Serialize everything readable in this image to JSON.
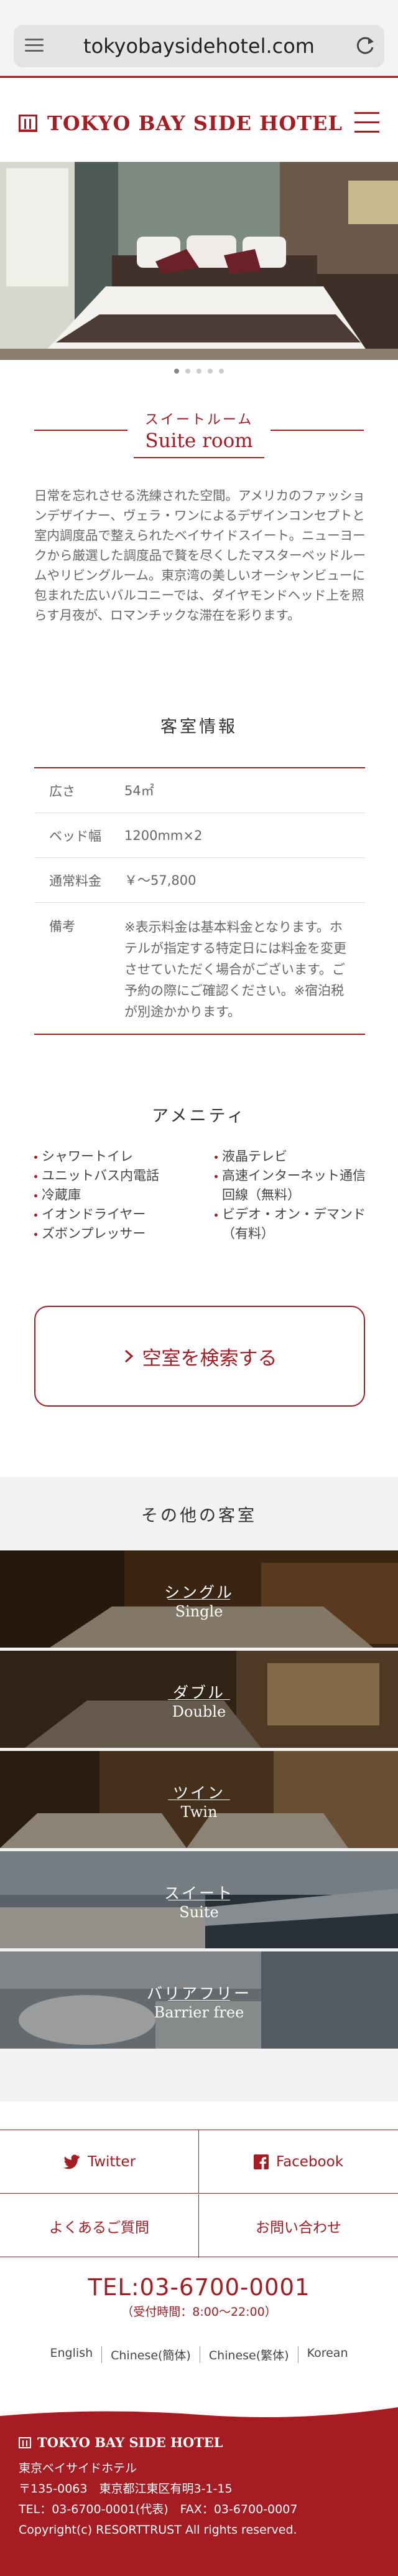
{
  "browser": {
    "url": "tokyobaysidehotel.com"
  },
  "header": {
    "logo_text": "TOKYO BAY SIDE HOTEL"
  },
  "room": {
    "title_ja": "スイートルーム",
    "title_en": "Suite room",
    "description": "日常を忘れさせる洗練された空間。アメリカのファッションデザイナー、ヴェラ・ワンによるデザインコンセプトと室内調度品で整えられたベイサイドスイート。ニューヨークから厳選した調度品で贅を尽くしたマスターベッドルームやリビングルーム。東京湾の美しいオーシャンビューに包まれた広いバルコニーでは、ダイヤモンドヘッド上を照らす月夜が、ロマンチックな滞在を彩ります。"
  },
  "specs": {
    "heading": "客室情報",
    "rows": [
      {
        "key": "広さ",
        "value": "54㎡"
      },
      {
        "key": "ベッド幅",
        "value": "1200mm×2"
      },
      {
        "key": "通常料金",
        "value": "￥～57,800"
      },
      {
        "key": "備考",
        "value": "※表示料金は基本料金となります。ホテルが指定する特定日には料金を変更させていただく場合がございます。ご予約の際にご確認ください。※宿泊税が別途かかります。"
      }
    ]
  },
  "amenities": {
    "heading": "アメニティ",
    "left": [
      "シャワートイレ",
      "ユニットバス内電話",
      "冷蔵庫",
      "イオンドライヤー",
      "ズボンプレッサー"
    ],
    "right": [
      "液晶テレビ",
      "高速インターネット通信回線（無料）",
      "ビデオ・オン・デマンド（有料）"
    ]
  },
  "search_button": {
    "label": "空室を検索する"
  },
  "other_rooms": {
    "heading": "その他の客室",
    "items": [
      {
        "ja": "シングル",
        "en": "Single"
      },
      {
        "ja": "ダブル",
        "en": "Double"
      },
      {
        "ja": "ツイン",
        "en": "Twin"
      },
      {
        "ja": "スイート",
        "en": "Suite"
      },
      {
        "ja": "バリアフリー",
        "en": "Barrier free"
      }
    ]
  },
  "links": {
    "twitter": "Twitter",
    "facebook": "Facebook",
    "faq": "よくあるご質問",
    "contact": "お問い合わせ"
  },
  "contact": {
    "tel": "TEL:03-6700-0001",
    "hours": "（受付時間：8:00～22:00）"
  },
  "languages": [
    "English",
    "Chinese(簡体)",
    "Chinese(繁体)",
    "Korean"
  ],
  "footer": {
    "logo_text": "TOKYO BAY SIDE HOTEL",
    "name": "東京ベイサイドホテル",
    "address": "〒135-0063　東京都江東区有明3-1-15",
    "tel_fax": "TEL：03-6700-0001(代表)　FAX：03-6700-0007",
    "copyright": "Copyright(c) RESORTTRUST All rights reserved."
  },
  "colors": {
    "brand": "#a51c23"
  }
}
